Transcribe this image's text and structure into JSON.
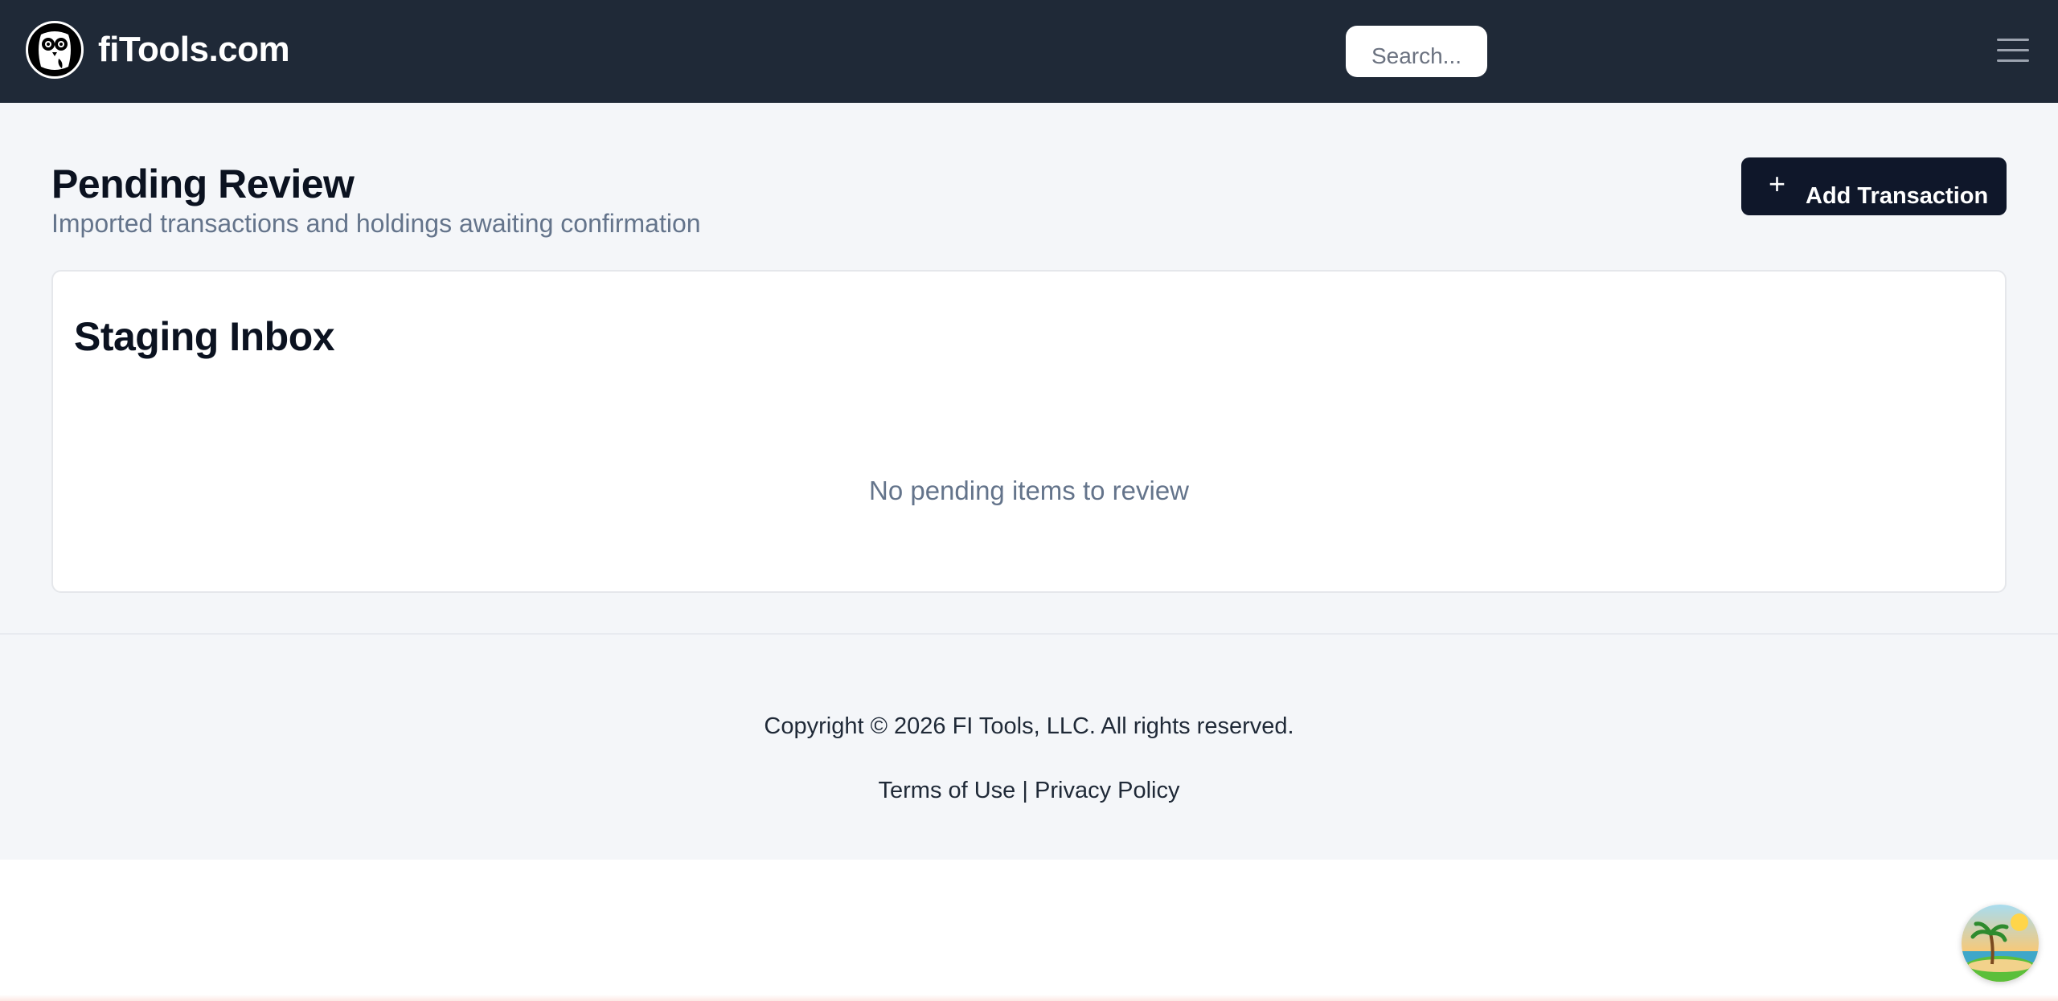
{
  "header": {
    "brand_name": "fiTools.com",
    "search_placeholder": "Search..."
  },
  "page": {
    "title": "Pending Review",
    "subtitle": "Imported transactions and holdings awaiting confirmation",
    "add_button_label": "Add Transaction",
    "add_button_icon": "plus-icon"
  },
  "card": {
    "title": "Staging Inbox",
    "empty_message": "No pending items to review"
  },
  "footer": {
    "copyright": "Copyright © 2026 FI Tools, LLC. All rights reserved.",
    "terms_label": "Terms of Use",
    "separator": "|",
    "privacy_label": "Privacy Policy"
  },
  "colors": {
    "navbar_bg": "#1f2937",
    "page_bg": "#f4f6f9",
    "primary_button": "#0f172a",
    "muted_text": "#64748b"
  },
  "icons": {
    "logo": "owl-logo-icon",
    "menu": "hamburger-menu-icon",
    "chat": "tropical-island-avatar-icon"
  }
}
